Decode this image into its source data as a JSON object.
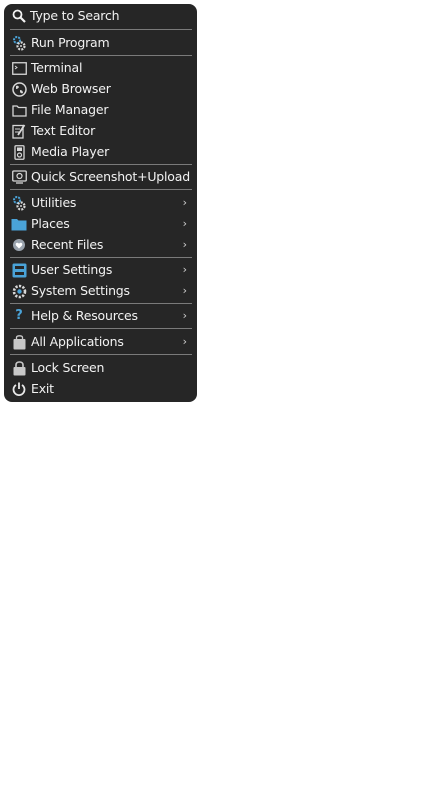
{
  "menu": {
    "search": {
      "label": "Type to Search",
      "icon": "search-icon"
    },
    "run": {
      "label": "Run Program",
      "icon": "gears-icon"
    },
    "terminal": {
      "label": "Terminal",
      "icon": "terminal-icon"
    },
    "browser": {
      "label": "Web Browser",
      "icon": "globe-icon"
    },
    "files": {
      "label": "File Manager",
      "icon": "folder-outline-icon"
    },
    "editor": {
      "label": "Text Editor",
      "icon": "text-editor-icon"
    },
    "media": {
      "label": "Media Player",
      "icon": "media-player-icon"
    },
    "screenshot": {
      "label": "Quick Screenshot+Upload",
      "icon": "screenshot-icon"
    },
    "utilities": {
      "label": "Utilities",
      "icon": "gears-icon",
      "arrow": "›"
    },
    "places": {
      "label": "Places",
      "icon": "folder-icon",
      "arrow": "›"
    },
    "recent": {
      "label": "Recent Files",
      "icon": "heart-icon",
      "arrow": "›"
    },
    "user_settings": {
      "label": "User Settings",
      "icon": "user-settings-icon",
      "arrow": "›"
    },
    "system_settings": {
      "label": "System Settings",
      "icon": "system-settings-icon",
      "arrow": "›"
    },
    "help": {
      "label": "Help & Resources",
      "icon": "question-icon",
      "arrow": "›"
    },
    "all_apps": {
      "label": "All Applications",
      "icon": "shopping-bag-icon",
      "arrow": "›"
    },
    "lock": {
      "label": "Lock Screen",
      "icon": "lock-icon"
    },
    "exit": {
      "label": "Exit",
      "icon": "power-icon"
    }
  },
  "colors": {
    "menu_background": "#262626",
    "text": "#f2f2f2",
    "separator": "#7a7a7a",
    "accent_blue": "#4aa3d8"
  }
}
